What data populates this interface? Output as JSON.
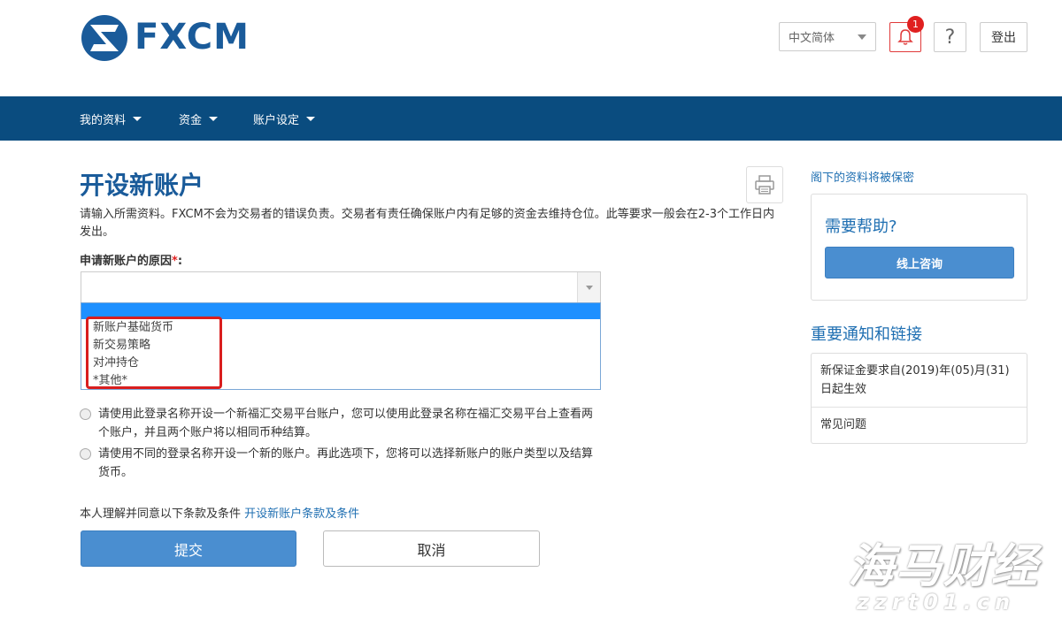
{
  "header": {
    "logo_text": "FXCM",
    "language": "中文简体",
    "notification_count": "1",
    "help_symbol": "?",
    "logout_label": "登出"
  },
  "nav": {
    "items": [
      {
        "label": "我的资料",
        "icon": "caret-down-icon"
      },
      {
        "label": "资金",
        "icon": "caret-down-icon"
      },
      {
        "label": "账户设定",
        "icon": "caret-down-icon"
      }
    ]
  },
  "main": {
    "title": "开设新账户",
    "intro": "请输入所需资料。FXCM不会为交易者的错误负责。交易者有责任确保账户内有足够的资金去维持仓位。此等要求一般会在2-3个工作日内发出。",
    "reason_label": "申请新账户的原因",
    "required_mark": "*",
    "reason_value": "",
    "dropdown_options": [
      "新账户基础货币",
      "新交易策略",
      "对冲持仓",
      "*其他*"
    ],
    "radio_options": [
      "请使用此登录名称开设一个新福汇交易平台账户，您可以使用此登录名称在福汇交易平台上查看两个账户，并且两个账户将以相同币种结算。",
      "请使用不同的登录名称开设一个新的账户。再此选项下，您将可以选择新账户的账户类型以及结算货币。"
    ],
    "terms_text": "本人理解并同意以下条款及条件",
    "terms_link": "开设新账户条款及条件",
    "submit_label": "提交",
    "cancel_label": "取消"
  },
  "sidebar": {
    "privacy_link": "阁下的资料将被保密",
    "help_title": "需要帮助?",
    "chat_label": "线上咨询",
    "notices_title": "重要通知和链接",
    "notices": [
      "新保证金要求自(2019)年(05)月(31)日起生效",
      "常见问题"
    ]
  },
  "watermark": {
    "main": "海马财经",
    "sub": "zzrt01.cn"
  },
  "colors": {
    "nav_bg": "#0a4c7f",
    "brand_blue": "#1a5b9a",
    "button_blue": "#4a8ed0",
    "link_blue": "#1f6fb2",
    "alert_red": "#e02020"
  }
}
